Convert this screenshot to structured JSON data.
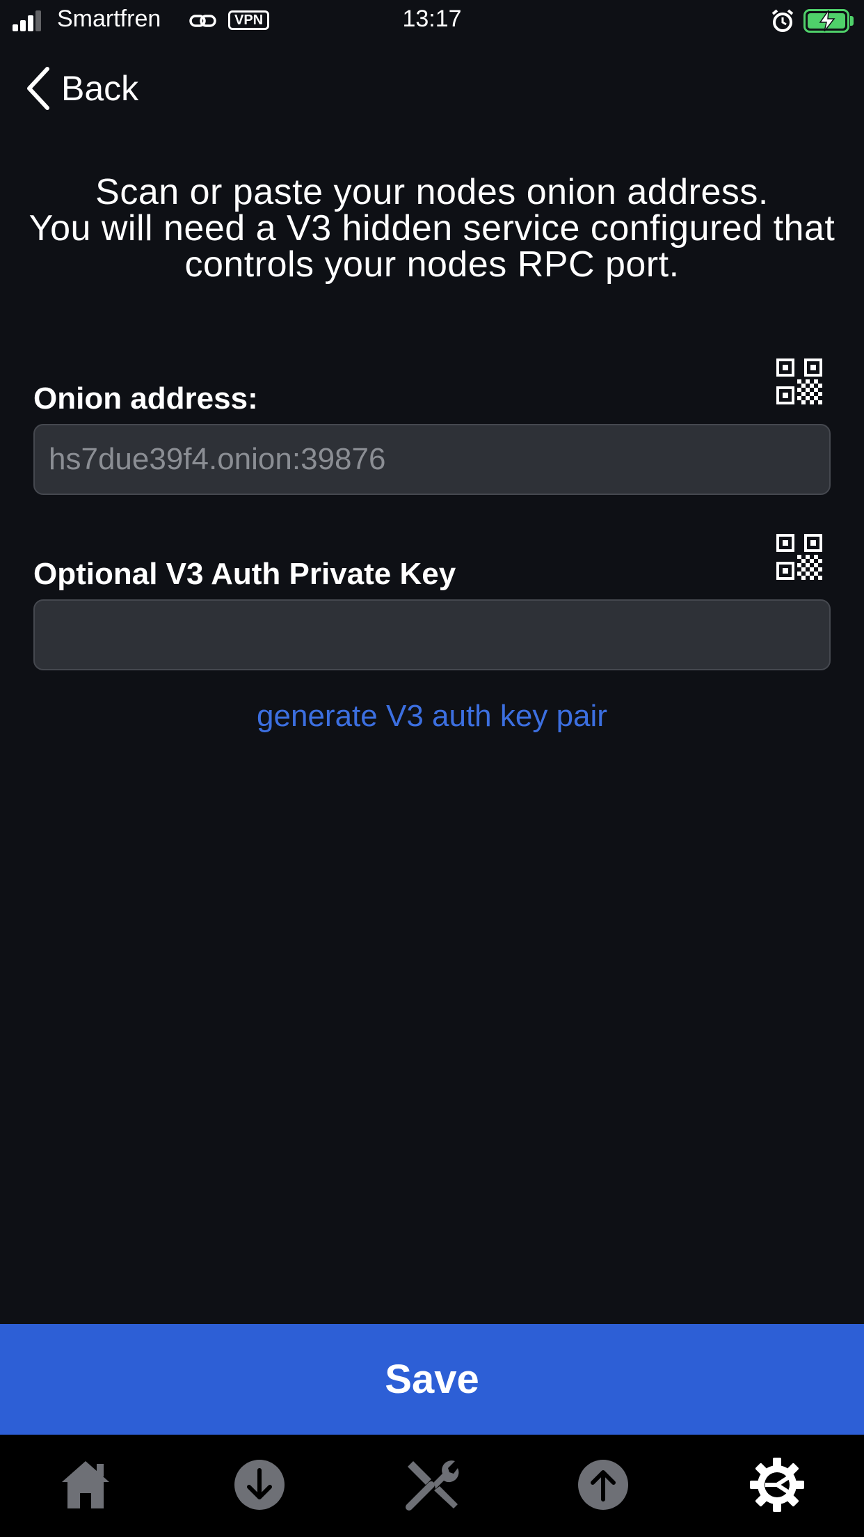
{
  "status_bar": {
    "carrier": "Smartfren",
    "vpn": "VPN",
    "time": "13:17"
  },
  "nav": {
    "back_label": "Back"
  },
  "instructions": "Scan or paste your nodes onion address.\nYou will need a V3 hidden service configured that controls your nodes RPC port.",
  "onion_field": {
    "label": "Onion address:",
    "value": "",
    "placeholder": "hs7due39f4.onion:39876"
  },
  "auth_field": {
    "label": "Optional V3 Auth Private Key",
    "value": "",
    "placeholder": ""
  },
  "generate_link": "generate V3 auth key pair",
  "save_label": "Save",
  "tabs": [
    {
      "icon": "home-icon",
      "active": false
    },
    {
      "icon": "arrow-down-circle-icon",
      "active": false
    },
    {
      "icon": "tools-icon",
      "active": false
    },
    {
      "icon": "arrow-up-circle-icon",
      "active": false
    },
    {
      "icon": "gear-icon",
      "active": true
    }
  ],
  "colors": {
    "background": "#0e1015",
    "accent": "#2d5fd6",
    "link": "#3c6fe0",
    "battery": "#4fd16a"
  }
}
